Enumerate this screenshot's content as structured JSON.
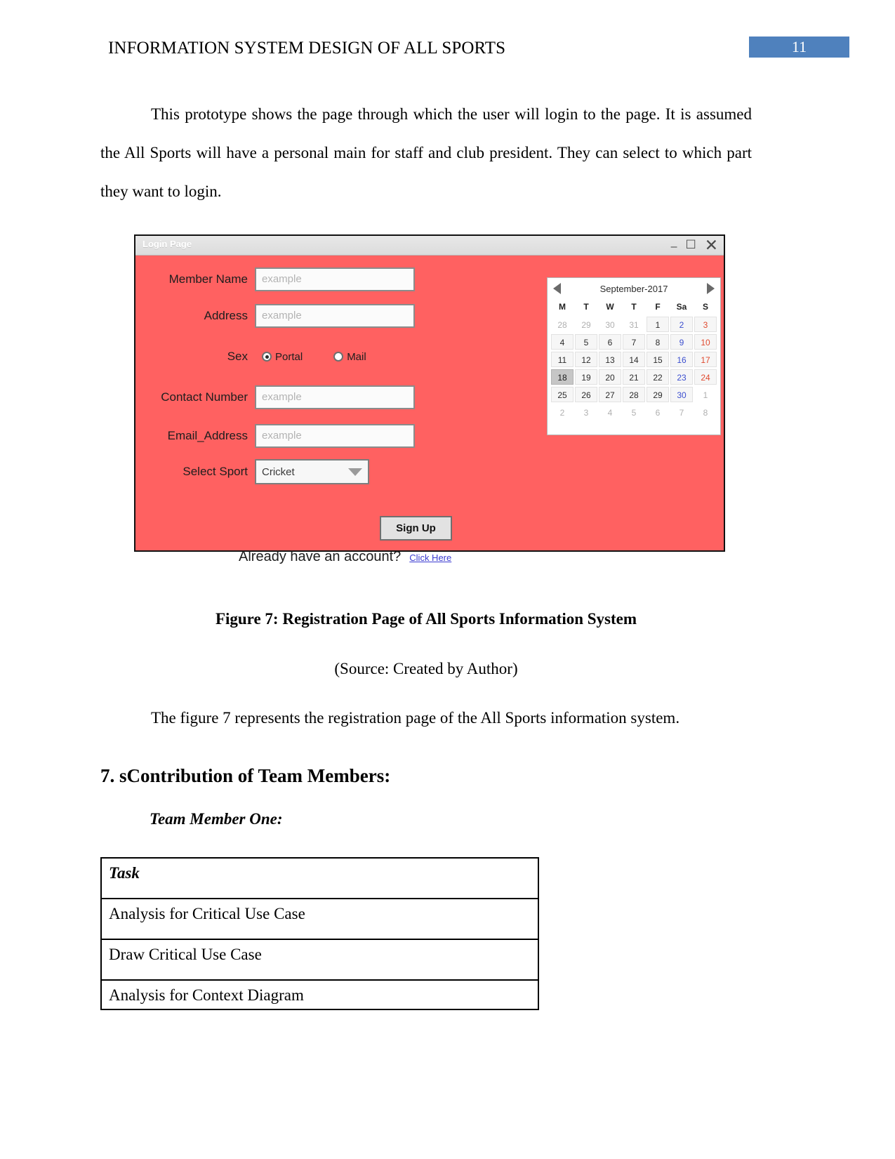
{
  "header": {
    "title": "INFORMATION SYSTEM DESIGN OF ALL SPORTS",
    "page_number": "11",
    "badge_color": "#4f81bd"
  },
  "body": {
    "intro_paragraph": "This prototype shows the page through which the user will login to the page. It is assumed the All Sports will have a personal main for staff and club president. They can select to which part they want to login.",
    "figure_caption": "Figure 7: Registration Page of All Sports Information System",
    "figure_source": "(Source: Created by Author)",
    "figure_description": "The figure 7 represents the registration page of the All Sports information system.",
    "section_heading": "7. sContribution of Team Members:",
    "sub_heading": "Team Member One:"
  },
  "mockup": {
    "window_title": "Login Page",
    "background_color": "#ff6161",
    "window_controls": {
      "minimize": "–",
      "maximize": "☐",
      "close": "✕"
    },
    "fields": [
      {
        "label": "Member Name",
        "placeholder": "example",
        "type": "text"
      },
      {
        "label": "Address",
        "placeholder": "example",
        "type": "text"
      },
      {
        "label": "Contact Number",
        "placeholder": "example",
        "type": "text"
      },
      {
        "label": "Email_Address",
        "placeholder": "example",
        "type": "text"
      }
    ],
    "sex": {
      "label": "Sex",
      "options": [
        {
          "label": "Portal",
          "selected": true
        },
        {
          "label": "Mail",
          "selected": false
        }
      ]
    },
    "select_sport": {
      "label": "Select Sport",
      "value": "Cricket"
    },
    "signup_button": "Sign Up",
    "account_prompt": "Already have an account?",
    "account_link": "Click Here",
    "link_color": "#3a3ad0"
  },
  "calendar": {
    "title": "September-2017",
    "prev_label": "◀",
    "next_label": "▶",
    "day_headers": [
      "M",
      "T",
      "W",
      "T",
      "F",
      "Sa",
      "S"
    ],
    "weeks": [
      [
        {
          "d": "28",
          "muted": true
        },
        {
          "d": "29",
          "muted": true
        },
        {
          "d": "30",
          "muted": true
        },
        {
          "d": "31",
          "muted": true
        },
        {
          "d": "1"
        },
        {
          "d": "2",
          "kind": "sat"
        },
        {
          "d": "3",
          "kind": "sun"
        }
      ],
      [
        {
          "d": "4"
        },
        {
          "d": "5"
        },
        {
          "d": "6"
        },
        {
          "d": "7"
        },
        {
          "d": "8"
        },
        {
          "d": "9",
          "kind": "sat"
        },
        {
          "d": "10",
          "kind": "sun"
        }
      ],
      [
        {
          "d": "11"
        },
        {
          "d": "12"
        },
        {
          "d": "13"
        },
        {
          "d": "14"
        },
        {
          "d": "15"
        },
        {
          "d": "16",
          "kind": "sat"
        },
        {
          "d": "17",
          "kind": "sun"
        }
      ],
      [
        {
          "d": "18",
          "today": true
        },
        {
          "d": "19"
        },
        {
          "d": "20"
        },
        {
          "d": "21"
        },
        {
          "d": "22"
        },
        {
          "d": "23",
          "kind": "sat"
        },
        {
          "d": "24",
          "kind": "sun"
        }
      ],
      [
        {
          "d": "25"
        },
        {
          "d": "26"
        },
        {
          "d": "27"
        },
        {
          "d": "28"
        },
        {
          "d": "29"
        },
        {
          "d": "30",
          "kind": "sat"
        },
        {
          "d": "1",
          "muted": true
        }
      ],
      [
        {
          "d": "2",
          "muted": true
        },
        {
          "d": "3",
          "muted": true
        },
        {
          "d": "4",
          "muted": true
        },
        {
          "d": "5",
          "muted": true
        },
        {
          "d": "6",
          "muted": true
        },
        {
          "d": "7",
          "muted": true
        },
        {
          "d": "8",
          "muted": true
        }
      ]
    ],
    "selected_day": "18"
  },
  "task_table": {
    "header": "Task",
    "rows": [
      "Analysis for Critical Use Case",
      "Draw Critical Use Case",
      "Analysis for Context Diagram"
    ]
  }
}
